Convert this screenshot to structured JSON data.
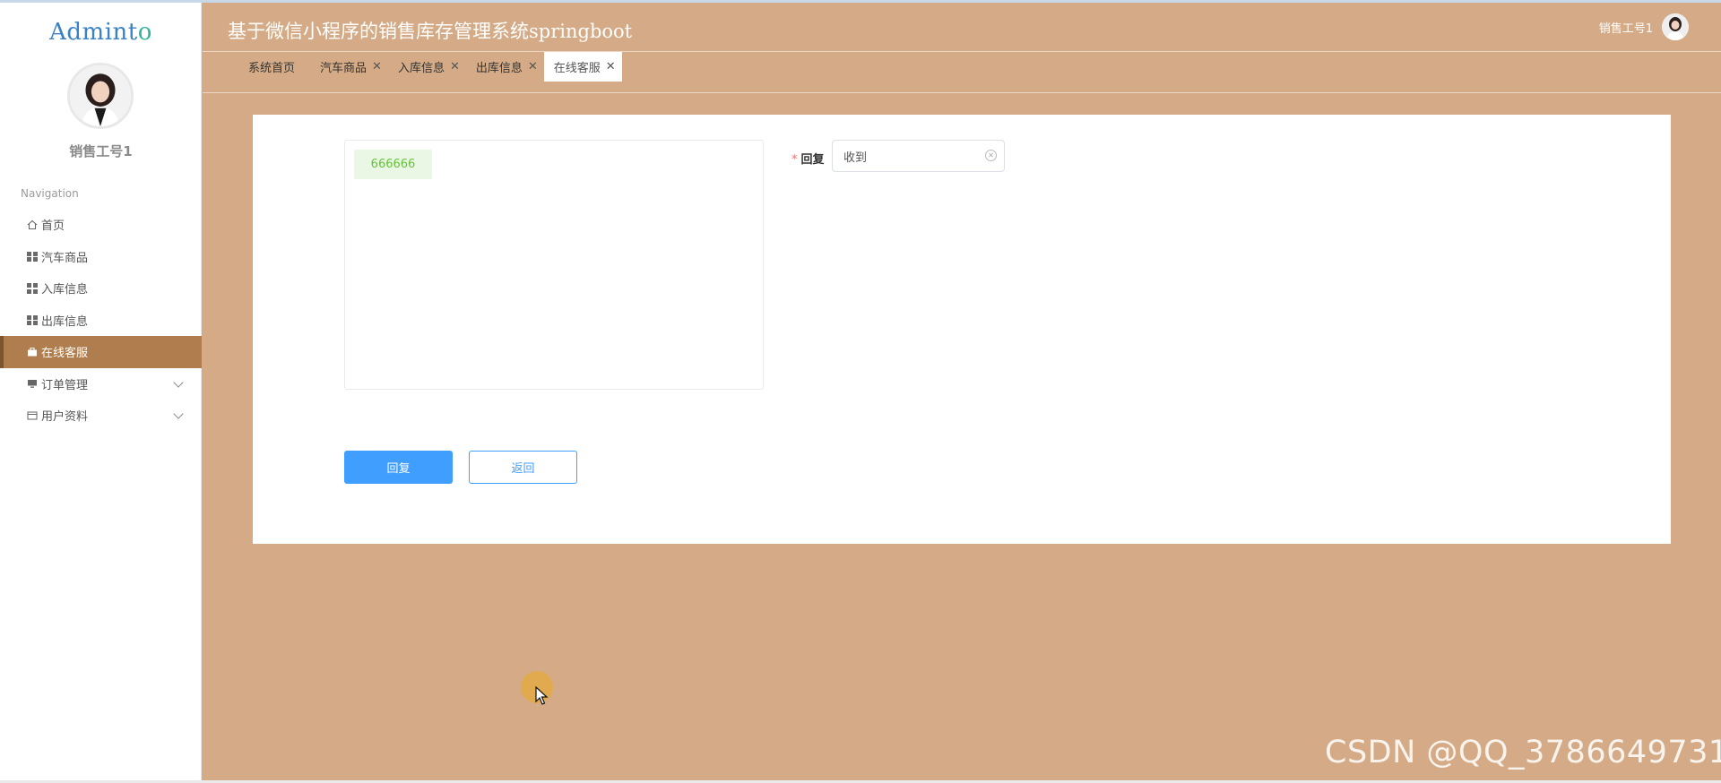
{
  "app": {
    "logo": "Adminto",
    "title": "基于微信小程序的销售库存管理系统springboot"
  },
  "user": {
    "name": "销售工号1",
    "header_name": "销售工号1"
  },
  "sidebar": {
    "section_title": "Navigation",
    "items": [
      {
        "label": "首页",
        "icon": "home-icon"
      },
      {
        "label": "汽车商品",
        "icon": "grid-icon"
      },
      {
        "label": "入库信息",
        "icon": "grid-icon"
      },
      {
        "label": "出库信息",
        "icon": "grid-icon"
      },
      {
        "label": "在线客服",
        "icon": "briefcase-icon",
        "active": true
      },
      {
        "label": "订单管理",
        "icon": "monitor-icon",
        "expandable": true
      },
      {
        "label": "用户资料",
        "icon": "card-icon",
        "expandable": true
      }
    ]
  },
  "tabs": [
    {
      "label": "系统首页",
      "closable": false
    },
    {
      "label": "汽车商品",
      "closable": true
    },
    {
      "label": "入库信息",
      "closable": true
    },
    {
      "label": "出库信息",
      "closable": true
    },
    {
      "label": "在线客服",
      "closable": true,
      "active": true
    }
  ],
  "chat": {
    "messages": [
      "666666"
    ]
  },
  "form": {
    "reply_label": "回复",
    "required_mark": "*",
    "reply_value": "收到",
    "submit_label": "回复",
    "back_label": "返回"
  },
  "watermark": "CSDN @QQ_3786649731",
  "colors": {
    "background": "#d4ab86",
    "sidebar_active": "#b07e4e",
    "primary": "#409eff",
    "message_bubble": "#e9f7e4"
  }
}
